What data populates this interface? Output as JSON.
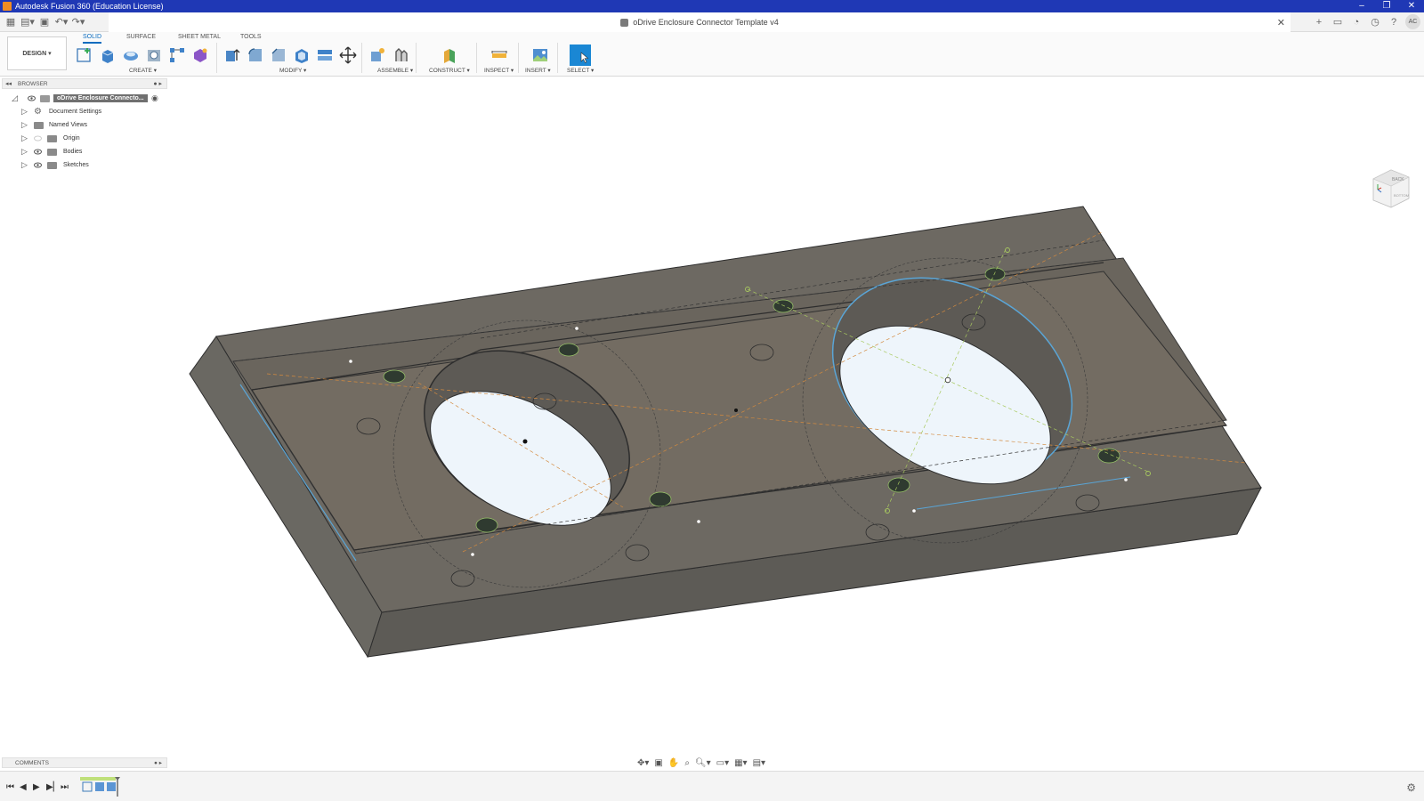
{
  "os_title": "Autodesk Fusion 360 (Education License)",
  "window_controls": {
    "minimize": "–",
    "restore": "❐",
    "close": "✕"
  },
  "document": {
    "title": "oDrive Enclosure Connector Template v4",
    "close": "✕"
  },
  "user_initials": "AC",
  "workspace": "DESIGN ▾",
  "ribbon_tabs": [
    {
      "label": "SOLID",
      "active": true
    },
    {
      "label": "SURFACE",
      "active": false
    },
    {
      "label": "SHEET METAL",
      "active": false
    },
    {
      "label": "TOOLS",
      "active": false
    }
  ],
  "ribbon_groups": {
    "create": "CREATE ▾",
    "modify": "MODIFY ▾",
    "assemble": "ASSEMBLE ▾",
    "construct": "CONSTRUCT ▾",
    "inspect": "INSPECT ▾",
    "insert": "INSERT ▾",
    "select": "SELECT ▾"
  },
  "browser": {
    "title": "BROWSER",
    "root": "oDrive Enclosure Connecto...",
    "items": [
      {
        "label": "Document Settings",
        "icon": "gear-icon"
      },
      {
        "label": "Named Views",
        "icon": "folder-icon"
      },
      {
        "label": "Origin",
        "icon": "folder-icon"
      },
      {
        "label": "Bodies",
        "icon": "folder-icon"
      },
      {
        "label": "Sketches",
        "icon": "folder-icon"
      }
    ]
  },
  "viewcube": {
    "face_label": "BACK",
    "face_label_2": "BOTTOM"
  },
  "comments": {
    "title": "COMMENTS"
  },
  "colors": {
    "os_titlebar": "#1f38b5",
    "accent": "#0b6cbf",
    "model_top": "#6b6760",
    "model_side": "#5f5d57",
    "hole_glass": "#eef5fb"
  }
}
